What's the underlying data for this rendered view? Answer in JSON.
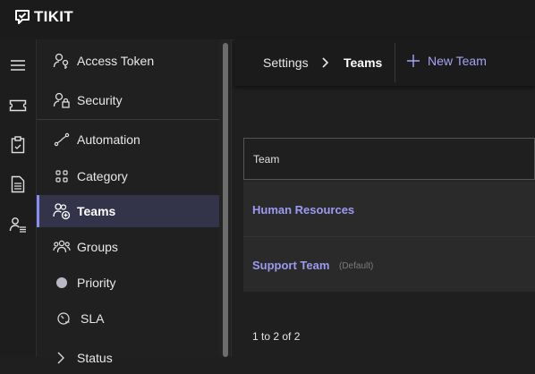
{
  "app": {
    "brand": "TIKIT"
  },
  "rail": {
    "items": [
      {
        "icon": "hamburger-menu-icon"
      },
      {
        "icon": "ticket-icon"
      },
      {
        "icon": "clipboard-icon"
      },
      {
        "icon": "document-icon"
      },
      {
        "icon": "people-list-icon"
      }
    ]
  },
  "sidebar": {
    "items": [
      {
        "label": "Access Token",
        "icon": "key-person-icon"
      },
      {
        "label": "Security",
        "icon": "person-lock-icon"
      },
      {
        "label": "Automation",
        "icon": "automation-flow-icon"
      },
      {
        "label": "Category",
        "icon": "grid-four-icon"
      },
      {
        "label": "Teams",
        "icon": "team-add-icon",
        "active": true
      },
      {
        "label": "Groups",
        "icon": "people-group-icon"
      },
      {
        "label": "Priority",
        "icon": "circle-dot-icon"
      },
      {
        "label": "SLA",
        "icon": "clock-gauge-icon"
      },
      {
        "label": "Status",
        "icon": "status-icon"
      }
    ]
  },
  "header": {
    "breadcrumb": {
      "parent": "Settings",
      "current": "Teams"
    },
    "new_team_label": "New Team"
  },
  "grid": {
    "column_header": "Team",
    "rows": [
      {
        "name": "Human Resources",
        "tag": ""
      },
      {
        "name": "Support Team",
        "tag": "(Default)"
      }
    ]
  },
  "pager": {
    "text": "1 to 2 of 2"
  },
  "colors": {
    "accent": "#8b8cf2",
    "link": "#9a9bf0",
    "active_bg": "#33344a"
  }
}
